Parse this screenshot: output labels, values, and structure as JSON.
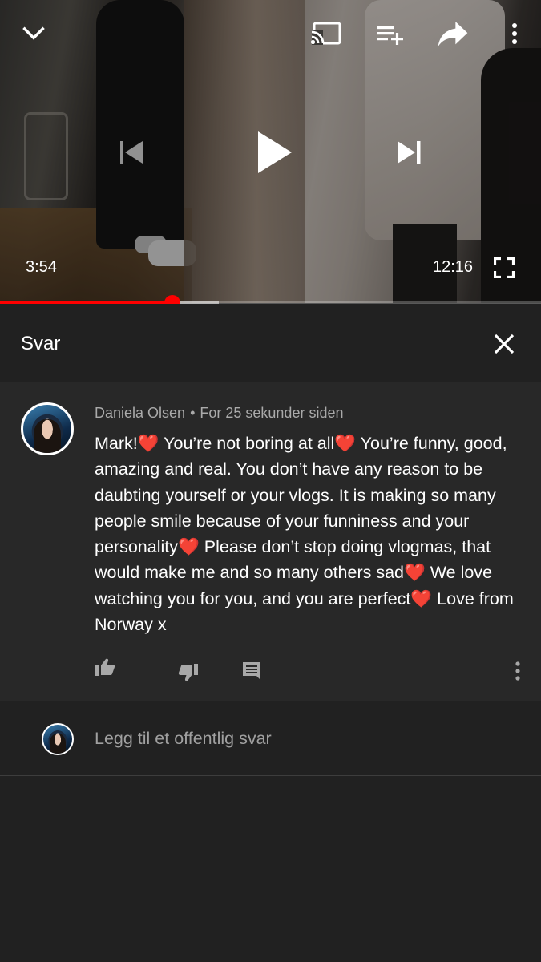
{
  "player": {
    "current_time": "3:54",
    "duration": "12:16",
    "played_fraction": 0.318,
    "buffered_fraction": 0.405,
    "icons": {
      "collapse": "chevron-down-icon",
      "cast": "cast-icon",
      "queue": "add-to-queue-icon",
      "share": "share-icon",
      "more": "more-vert-icon",
      "previous": "skip-previous-icon",
      "play": "play-icon",
      "next": "skip-next-icon",
      "fullscreen": "fullscreen-icon"
    },
    "accent_color": "#ff0000"
  },
  "reply_panel": {
    "title": "Svar",
    "close_icon": "close-icon"
  },
  "comment": {
    "author": "Daniela Olsen",
    "separator": "•",
    "time_ago": "For 25 sekunder siden",
    "segments": [
      "Mark!",
      " You’re not boring at all",
      " You’re funny, good, amazing and real. You don’t have any reason to be daubting yourself or your vlogs. It is making so many people smile because of your funniness and your personality",
      " Please don’t stop doing vlogmas, that would make me and so many others sad",
      " We love watching you for you, and you are perfect",
      " Love from Norway x"
    ],
    "heart": "❤️",
    "actions": {
      "like_icon": "thumb-up-icon",
      "dislike_icon": "thumb-down-icon",
      "reply_icon": "comment-icon",
      "more_icon": "more-vert-icon"
    }
  },
  "add_reply": {
    "placeholder": "Legg til et offentlig svar"
  },
  "colors": {
    "background": "#212121",
    "comment_background": "#282828",
    "secondary_text": "#aaaaaa",
    "heart": "#e8202d"
  }
}
